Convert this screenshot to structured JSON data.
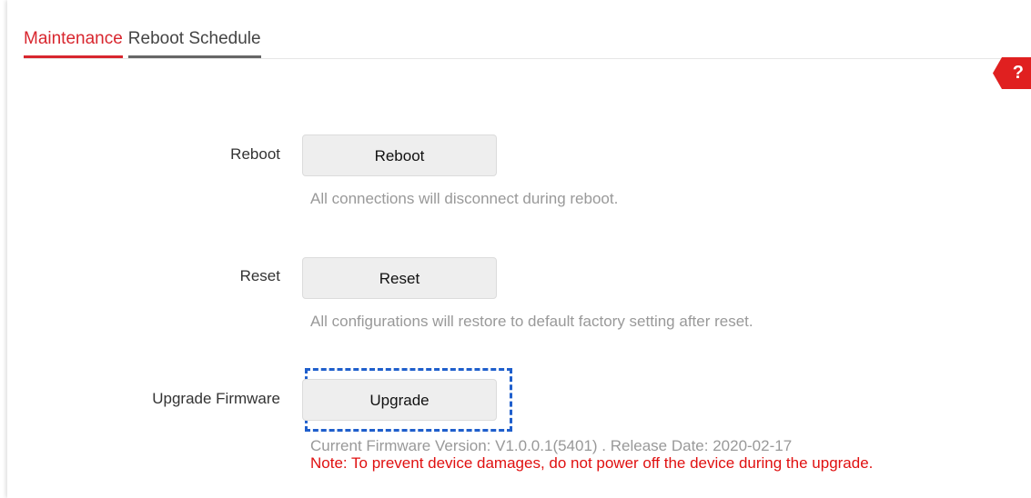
{
  "tabs": [
    {
      "label": "Maintenance",
      "active": true
    },
    {
      "label": "Reboot Schedule",
      "active": false
    }
  ],
  "help": {
    "symbol": "?",
    "color": "#e02020"
  },
  "reboot": {
    "label": "Reboot",
    "button": "Reboot",
    "hint": "All connections will disconnect during reboot."
  },
  "reset": {
    "label": "Reset",
    "button": "Reset",
    "hint": "All configurations will restore to default factory setting after reset."
  },
  "upgrade": {
    "label": "Upgrade Firmware",
    "button": "Upgrade",
    "version_info": "Current Firmware Version: V1.0.0.1(5401) . Release Date: 2020-02-17",
    "note": "Note: To prevent device damages, do not power off the device during the upgrade."
  },
  "colors": {
    "accent": "#d8262e",
    "highlight": "#1f5fcc",
    "warning": "#e01010"
  }
}
